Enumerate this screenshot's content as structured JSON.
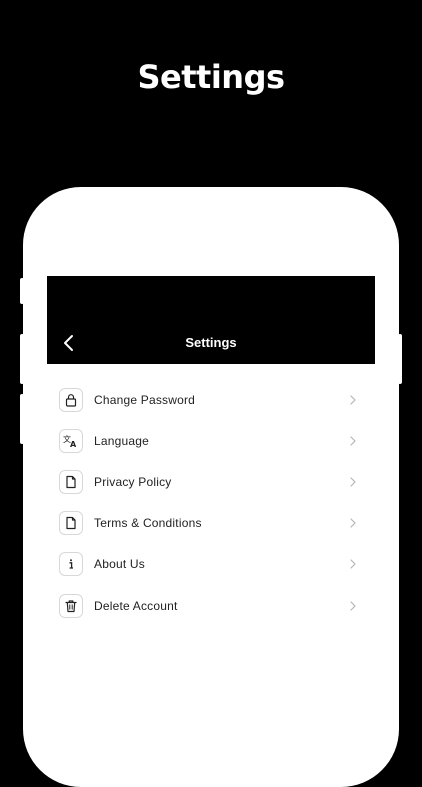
{
  "promo": {
    "title": "Settings"
  },
  "header": {
    "title": "Settings",
    "back_icon": "chevron-left-icon"
  },
  "menu": {
    "items": [
      {
        "label": "Change Password",
        "icon": "lock-icon"
      },
      {
        "label": "Language",
        "icon": "translate-icon"
      },
      {
        "label": "Privacy Policy",
        "icon": "document-icon"
      },
      {
        "label": "Terms & Conditions",
        "icon": "document-icon"
      },
      {
        "label": "About Us",
        "icon": "info-icon"
      },
      {
        "label": "Delete Account",
        "icon": "trash-icon"
      }
    ]
  },
  "colors": {
    "background": "#000000",
    "surface": "#ffffff",
    "text": "#222222",
    "chevron": "#b5b5b5"
  }
}
